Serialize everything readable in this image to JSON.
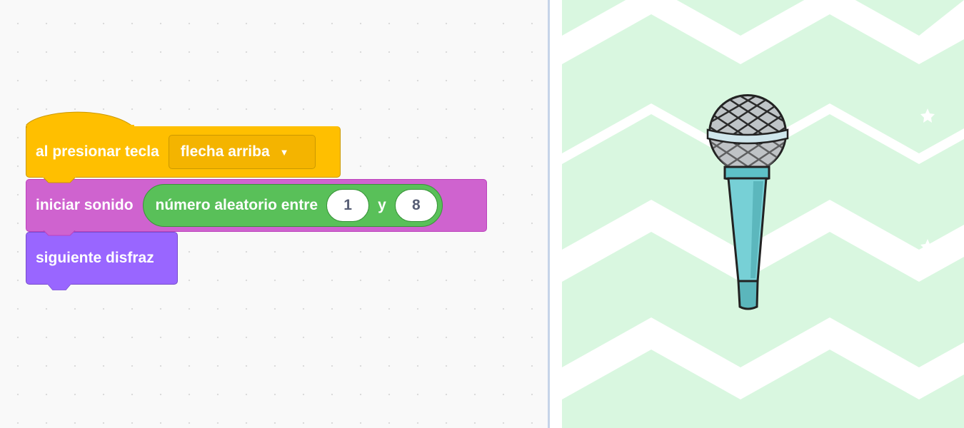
{
  "blocks": {
    "hat": {
      "label": "al presionar tecla",
      "dropdown_value": "flecha arriba",
      "dropdown_arrow": "▼",
      "color": "#ffbf00"
    },
    "sound": {
      "label": "iniciar sonido",
      "color": "#cf63cf",
      "reporter": {
        "label": "número aleatorio entre",
        "from": "1",
        "joiner": "y",
        "to": "8",
        "color": "#59c059"
      }
    },
    "looks": {
      "label": "siguiente disfraz",
      "color": "#9966ff"
    }
  },
  "stage": {
    "sprite_icon": "microphone-icon",
    "backdrop_color": "#d9f7e0"
  }
}
